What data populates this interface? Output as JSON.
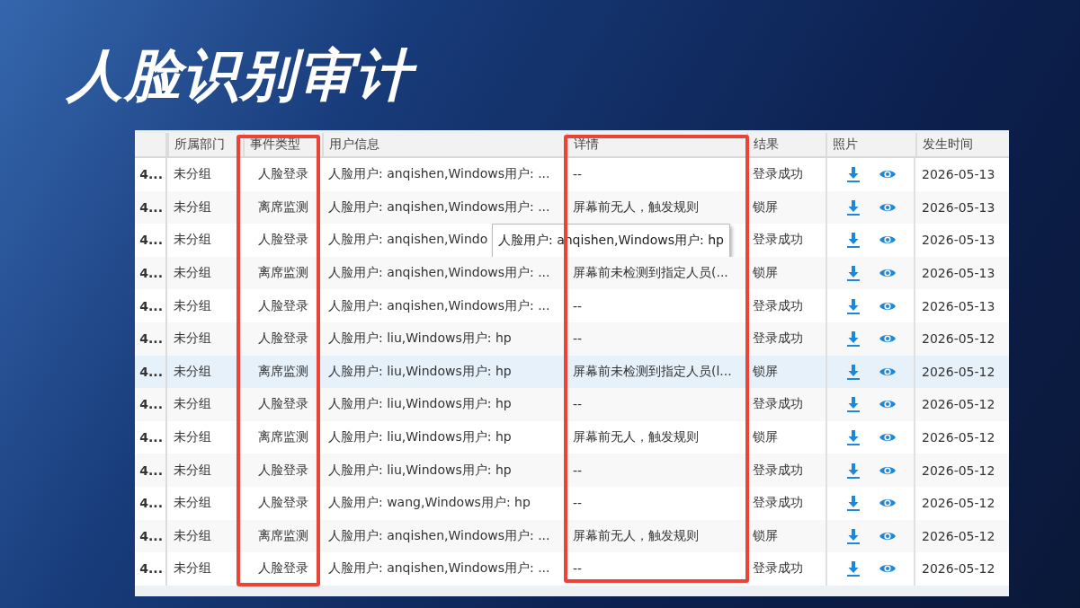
{
  "slide": {
    "title": "人脸识别审计"
  },
  "table": {
    "columns": [
      "所属部门",
      "事件类型",
      "用户信息",
      "详情",
      "结果",
      "照片",
      "发生时间"
    ],
    "rows": [
      {
        "column_0": "4...",
        "department": "未分组",
        "event_type": "人脸登录",
        "user_info": "人脸用户: anqishen,Windows用户: ...",
        "details": "--",
        "result": "登录成功",
        "time": "2026-05-13",
        "selected": false
      },
      {
        "column_0": "4...",
        "department": "未分组",
        "event_type": "离席监测",
        "user_info": "人脸用户: anqishen,Windows用户: ...",
        "details": "屏幕前无人，触发规则",
        "result": "锁屏",
        "time": "2026-05-13",
        "selected": false
      },
      {
        "column_0": "4...",
        "department": "未分组",
        "event_type": "人脸登录",
        "user_info": "人脸用户: anqishen,Windo",
        "tooltip": "人脸用户: anqishen,Windows用户: hp",
        "result": "登录成功",
        "time": "2026-05-13",
        "selected": false
      },
      {
        "column_0": "4...",
        "department": "未分组",
        "event_type": "离席监测",
        "user_info": "人脸用户: anqishen,Windows用户: ...",
        "details": "屏幕前未检测到指定人员(...",
        "result": "锁屏",
        "time": "2026-05-13",
        "selected": false
      },
      {
        "column_0": "4...",
        "department": "未分组",
        "event_type": "人脸登录",
        "user_info": "人脸用户: anqishen,Windows用户: ...",
        "details": "--",
        "result": "登录成功",
        "time": "2026-05-13",
        "selected": false
      },
      {
        "column_0": "4...",
        "department": "未分组",
        "event_type": "人脸登录",
        "user_info": "人脸用户: liu,Windows用户: hp",
        "details": "--",
        "result": "登录成功",
        "time": "2026-05-12",
        "selected": false
      },
      {
        "column_0": "4...",
        "department": "未分组",
        "event_type": "离席监测",
        "user_info": "人脸用户: liu,Windows用户: hp",
        "details": "屏幕前未检测到指定人员(l...",
        "result": "锁屏",
        "time": "2026-05-12",
        "selected": true
      },
      {
        "column_0": "4...",
        "department": "未分组",
        "event_type": "人脸登录",
        "user_info": "人脸用户: liu,Windows用户: hp",
        "details": "--",
        "result": "登录成功",
        "time": "2026-05-12",
        "selected": false
      },
      {
        "column_0": "4...",
        "department": "未分组",
        "event_type": "离席监测",
        "user_info": "人脸用户: liu,Windows用户: hp",
        "details": "屏幕前无人，触发规则",
        "result": "锁屏",
        "time": "2026-05-12",
        "selected": false
      },
      {
        "column_0": "4...",
        "department": "未分组",
        "event_type": "人脸登录",
        "user_info": "人脸用户: liu,Windows用户: hp",
        "details": "--",
        "result": "登录成功",
        "time": "2026-05-12",
        "selected": false
      },
      {
        "column_0": "4...",
        "department": "未分组",
        "event_type": "人脸登录",
        "user_info": "人脸用户: wang,Windows用户: hp",
        "details": "--",
        "result": "登录成功",
        "time": "2026-05-12",
        "selected": false
      },
      {
        "column_0": "4...",
        "department": "未分组",
        "event_type": "离席监测",
        "user_info": "人脸用户: anqishen,Windows用户: ...",
        "details": "屏幕前无人，触发规则",
        "result": "锁屏",
        "time": "2026-05-12",
        "selected": false
      },
      {
        "column_0": "4...",
        "department": "未分组",
        "event_type": "人脸登录",
        "user_info": "人脸用户: anqishen,Windows用户: ...",
        "details": "--",
        "result": "登录成功",
        "time": "2026-05-12",
        "selected": false
      }
    ]
  }
}
